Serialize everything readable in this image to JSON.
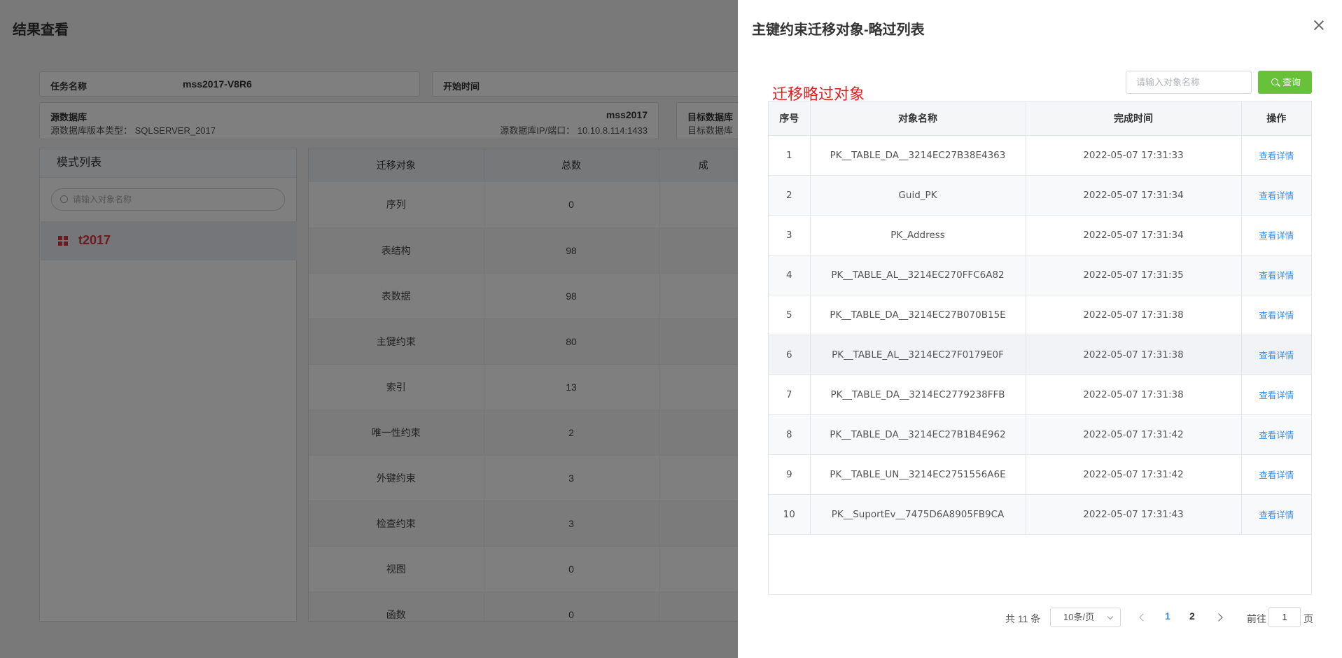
{
  "background": {
    "page_title": "结果查看",
    "task_label": "任务名称",
    "task_name": "mss2017-V8R6",
    "start_time_label": "开始时间",
    "source_db_label": "源数据库",
    "source_db_name": "mss2017",
    "source_version_text": "源数据库版本类型： SQLSERVER_2017",
    "source_ip_text": "源数据库IP/端口： 10.10.8.114:1433",
    "target_db_label": "目标数据库",
    "target_version_text": "目标数据库",
    "schema_panel_title": "模式列表",
    "schema_search_placeholder": "请输入对象名称",
    "schema_item": "t2017",
    "obj_headers": [
      "迁移对象",
      "总数",
      "成"
    ],
    "obj_rows": [
      {
        "name": "序列",
        "total": "0"
      },
      {
        "name": "表结构",
        "total": "98"
      },
      {
        "name": "表数据",
        "total": "98"
      },
      {
        "name": "主键约束",
        "total": "80"
      },
      {
        "name": "索引",
        "total": "13"
      },
      {
        "name": "唯一性约束",
        "total": "2"
      },
      {
        "name": "外键约束",
        "total": "3"
      },
      {
        "name": "检查约束",
        "total": "3"
      },
      {
        "name": "视图",
        "total": "0"
      },
      {
        "name": "函数",
        "total": "0"
      }
    ]
  },
  "drawer": {
    "title": "主键约束迁移对象-略过列表",
    "skip_heading": "迁移略过对象",
    "search_placeholder": "请输入对象名称",
    "query_label": "查询",
    "columns": [
      "序号",
      "对象名称",
      "完成时间",
      "操作"
    ],
    "rows": [
      {
        "idx": "1",
        "name": "PK__TABLE_DA__3214EC27B38E4363",
        "time": "2022-05-07 17:31:33",
        "action": "查看详情"
      },
      {
        "idx": "2",
        "name": "Guid_PK",
        "time": "2022-05-07 17:31:34",
        "action": "查看详情"
      },
      {
        "idx": "3",
        "name": "PK_Address",
        "time": "2022-05-07 17:31:34",
        "action": "查看详情"
      },
      {
        "idx": "4",
        "name": "PK__TABLE_AL__3214EC270FFC6A82",
        "time": "2022-05-07 17:31:35",
        "action": "查看详情"
      },
      {
        "idx": "5",
        "name": "PK__TABLE_DA__3214EC27B070B15E",
        "time": "2022-05-07 17:31:38",
        "action": "查看详情"
      },
      {
        "idx": "6",
        "name": "PK__TABLE_AL__3214EC27F0179E0F",
        "time": "2022-05-07 17:31:38",
        "action": "查看详情"
      },
      {
        "idx": "7",
        "name": "PK__TABLE_DA__3214EC2779238FFB",
        "time": "2022-05-07 17:31:38",
        "action": "查看详情"
      },
      {
        "idx": "8",
        "name": "PK__TABLE_DA__3214EC27B1B4E962",
        "time": "2022-05-07 17:31:42",
        "action": "查看详情"
      },
      {
        "idx": "9",
        "name": "PK__TABLE_UN__3214EC2751556A6E",
        "time": "2022-05-07 17:31:42",
        "action": "查看详情"
      },
      {
        "idx": "10",
        "name": "PK__SuportEv__7475D6A8905FB9CA",
        "time": "2022-05-07 17:31:43",
        "action": "查看详情"
      }
    ],
    "pagination": {
      "total_text": "共 11 条",
      "page_size": "10条/页",
      "pages": [
        "1",
        "2"
      ],
      "current_page": "1",
      "goto_label": "前往",
      "goto_value": "1",
      "goto_suffix": "页"
    }
  },
  "colors": {
    "accent_blue": "#3a8ee6",
    "query_green": "#67c23a",
    "heading_red": "#e02020",
    "schema_red": "#d9373f"
  }
}
